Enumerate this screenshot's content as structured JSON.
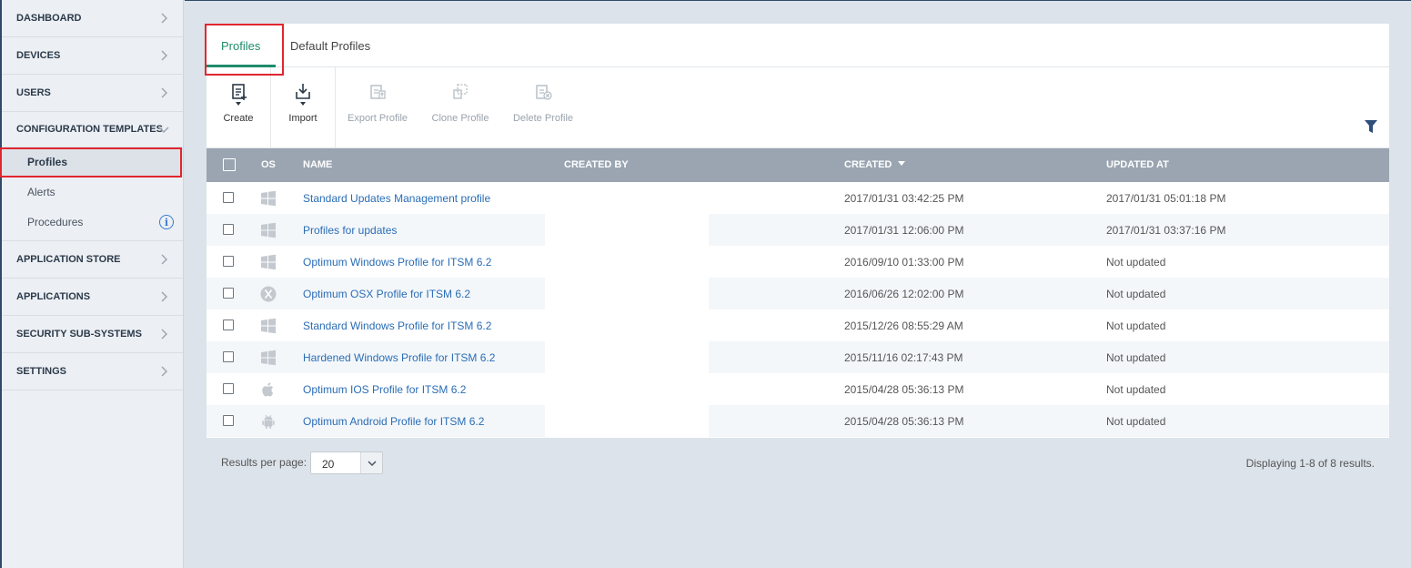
{
  "sidebar": {
    "items": [
      {
        "label": "DASHBOARD"
      },
      {
        "label": "DEVICES"
      },
      {
        "label": "USERS"
      },
      {
        "label": "CONFIGURATION TEMPLATES"
      },
      {
        "label": "APPLICATION STORE"
      },
      {
        "label": "APPLICATIONS"
      },
      {
        "label": "SECURITY SUB-SYSTEMS"
      },
      {
        "label": "SETTINGS"
      }
    ],
    "subitems": [
      {
        "label": "Profiles"
      },
      {
        "label": "Alerts"
      },
      {
        "label": "Procedures"
      }
    ],
    "info_glyph": "i"
  },
  "tabs": [
    {
      "label": "Profiles"
    },
    {
      "label": "Default Profiles"
    }
  ],
  "toolbar": {
    "create": "Create",
    "import": "Import",
    "export": "Export Profile",
    "clone": "Clone Profile",
    "delete": "Delete Profile"
  },
  "table": {
    "headers": {
      "os": "OS",
      "name": "NAME",
      "created_by": "CREATED BY",
      "created": "CREATED",
      "updated_at": "UPDATED AT"
    },
    "rows": [
      {
        "os": "windows-icon",
        "name": "Standard Updates Management profile",
        "created": "2017/01/31 03:42:25 PM",
        "updated": "2017/01/31 05:01:18 PM"
      },
      {
        "os": "windows-icon",
        "name": "Profiles for updates",
        "created": "2017/01/31 12:06:00 PM",
        "updated": "2017/01/31 03:37:16 PM"
      },
      {
        "os": "windows-icon",
        "name": "Optimum Windows Profile for ITSM 6.2",
        "created": "2016/09/10 01:33:00 PM",
        "updated": "Not updated"
      },
      {
        "os": "osx-icon",
        "name": "Optimum OSX Profile for ITSM 6.2",
        "created": "2016/06/26 12:02:00 PM",
        "updated": "Not updated"
      },
      {
        "os": "windows-icon",
        "name": "Standard Windows Profile for ITSM 6.2",
        "created": "2015/12/26 08:55:29 AM",
        "updated": "Not updated"
      },
      {
        "os": "windows-icon",
        "name": "Hardened Windows Profile for ITSM 6.2",
        "created": "2015/11/16 02:17:43 PM",
        "updated": "Not updated"
      },
      {
        "os": "apple-icon",
        "name": "Optimum IOS Profile for ITSM 6.2",
        "created": "2015/04/28 05:36:13 PM",
        "updated": "Not updated"
      },
      {
        "os": "android-icon",
        "name": "Optimum Android Profile for ITSM 6.2",
        "created": "2015/04/28 05:36:13 PM",
        "updated": "Not updated"
      }
    ]
  },
  "footer": {
    "results_label": "Results per page:",
    "per_page": "20",
    "displaying": "Displaying 1-8 of 8 results."
  },
  "colors": {
    "accent": "#1f8c6a",
    "link": "#2a6db5",
    "highlight": "#e0262f",
    "header_bg": "#9aa5b1"
  }
}
